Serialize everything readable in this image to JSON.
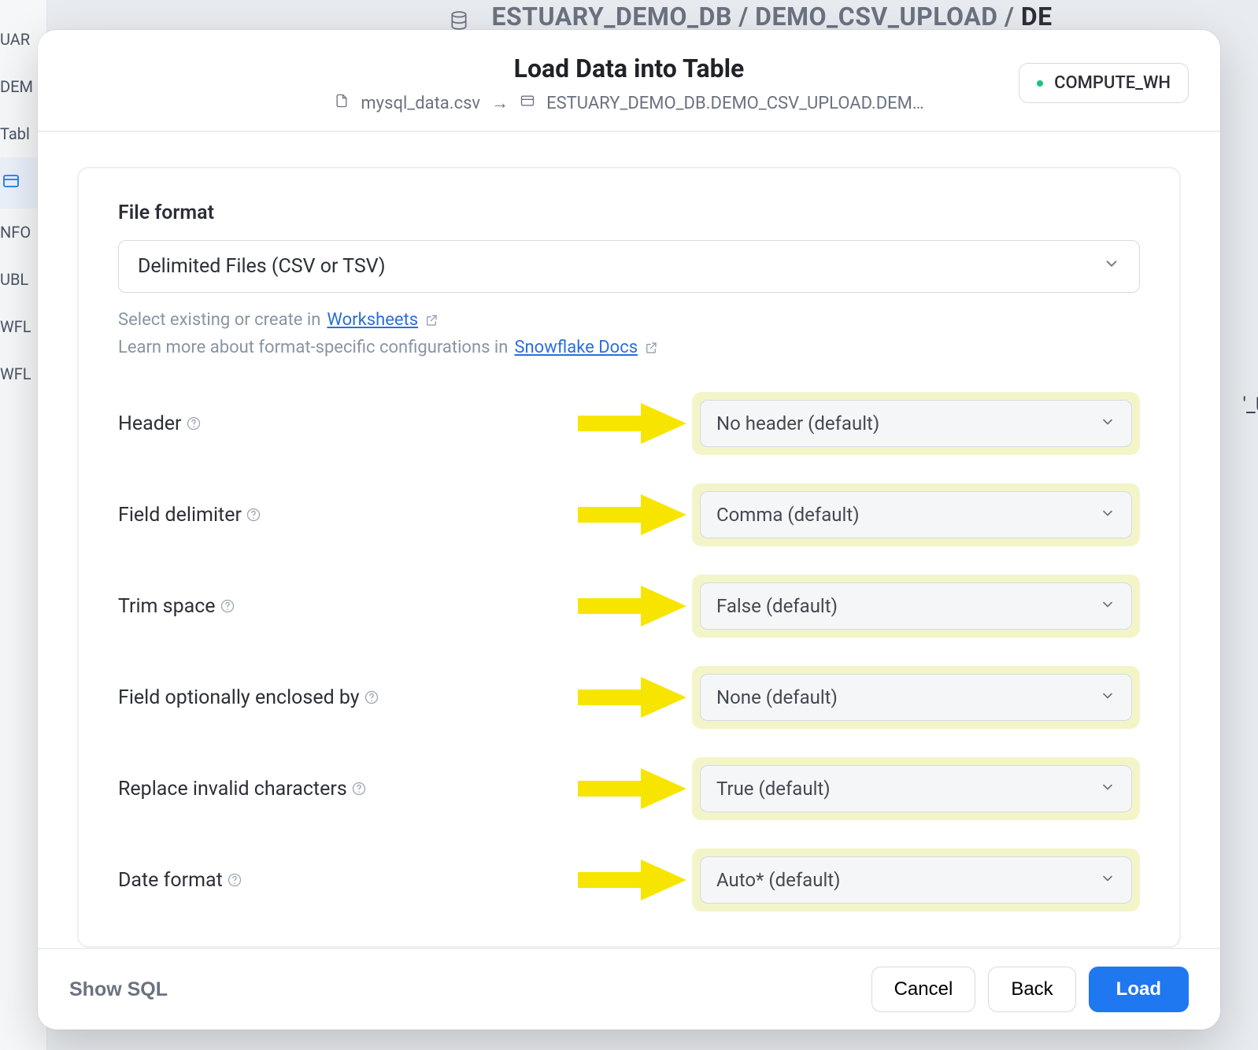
{
  "background": {
    "breadcrumb_part1": "ESTUARY_DEMO_DB",
    "breadcrumb_part2": "DEMO_CSV_UPLOAD",
    "breadcrumb_part3": "DE",
    "sidebar_items": [
      "UAR",
      "DEM",
      "Tabl",
      "",
      "NFO",
      "UBL",
      "WFL",
      "WFL"
    ],
    "right_frag": "'_UP"
  },
  "modal": {
    "title": "Load Data into Table",
    "source_file": "mysql_data.csv",
    "dest_table": "ESTUARY_DEMO_DB.DEMO_CSV_UPLOAD.DEM…",
    "warehouse": "COMPUTE_WH"
  },
  "panel": {
    "section_heading": "File format",
    "file_format_value": "Delimited Files (CSV or TSV)",
    "helper1_prefix": "Select existing or create in ",
    "helper1_link": "Worksheets",
    "helper2_prefix": "Learn more about format-specific configurations in ",
    "helper2_link": "Snowflake Docs"
  },
  "config": [
    {
      "label": "Header",
      "value": "No header (default)"
    },
    {
      "label": "Field delimiter",
      "value": "Comma (default)"
    },
    {
      "label": "Trim space",
      "value": "False (default)"
    },
    {
      "label": "Field optionally enclosed by",
      "value": "None (default)"
    },
    {
      "label": "Replace invalid characters",
      "value": "True (default)"
    },
    {
      "label": "Date format",
      "value": "Auto* (default)"
    }
  ],
  "footer": {
    "show_sql": "Show SQL",
    "cancel": "Cancel",
    "back": "Back",
    "load": "Load"
  }
}
